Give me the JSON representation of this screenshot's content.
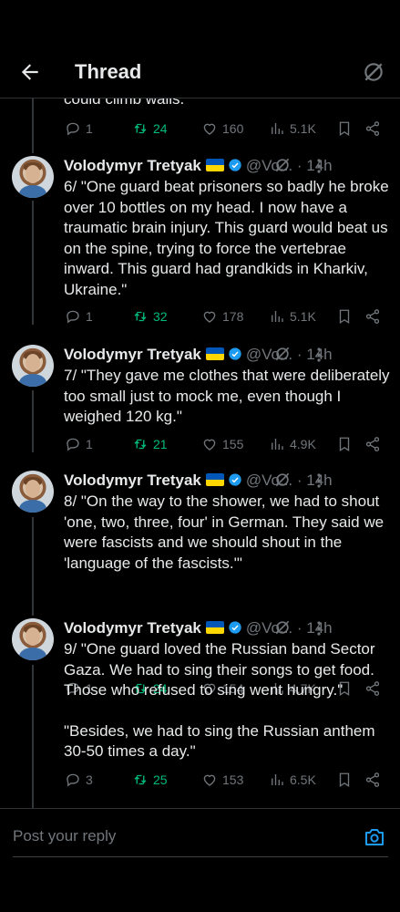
{
  "header": {
    "title": "Thread",
    "back_icon": "arrow-left-icon",
    "grok_icon": "grok-icon"
  },
  "partial_previous": {
    "text_fragment": "could climb walls.",
    "replies": "1",
    "reposts": "24",
    "likes": "160",
    "views": "5.1K"
  },
  "tweets": [
    {
      "name": "Volodymyr Tretyak",
      "handle": "@Vo...",
      "time": "· 14h",
      "paragraphs": [
        "6/ \"One guard beat prisoners so badly he broke over 10 bottles on my head. I now have a traumatic brain injury. This guard would beat us on the spine, trying to force the vertebrae inward. This guard had grandkids in Kharkiv, Ukraine.\""
      ],
      "replies": "1",
      "reposts": "32",
      "likes": "178",
      "views": "5.1K"
    },
    {
      "name": "Volodymyr Tretyak",
      "handle": "@Vo...",
      "time": "· 14h",
      "paragraphs": [
        "7/ \"They gave me clothes that were deliberately too small just to mock me, even though I weighed 120 kg.\""
      ],
      "replies": "1",
      "reposts": "21",
      "likes": "155",
      "views": "4.9K"
    },
    {
      "name": "Volodymyr Tretyak",
      "handle": "@Vo...",
      "time": "· 14h",
      "paragraphs": [
        "8/ \"On the way to the shower, we had to shout 'one, two, three, four' in German. They said we were fascists and we should shout in the 'language of the fascists.'\""
      ],
      "replies": "1",
      "reposts": "24",
      "likes": "154",
      "views": "4.7K"
    },
    {
      "name": "Volodymyr Tretyak",
      "handle": "@Vo...",
      "time": "· 14h",
      "paragraphs": [
        "9/ \"One guard loved the Russian band Sector Gaza. We had to sing their songs to get food. Those who refused to sing went hungry.\"",
        "\"Besides, we had to sing the Russian anthem 30-50 times a day.\""
      ],
      "replies": "3",
      "reposts": "25",
      "likes": "153",
      "views": "6.5K"
    }
  ],
  "reply_bar": {
    "placeholder": "Post your reply",
    "camera_icon": "camera-icon"
  },
  "colors": {
    "background": "#000000",
    "text": "#e7e9ea",
    "muted": "#71767b",
    "repost": "#00ba7c",
    "accent": "#1d9bf0",
    "verified": "#1d9bf0"
  }
}
